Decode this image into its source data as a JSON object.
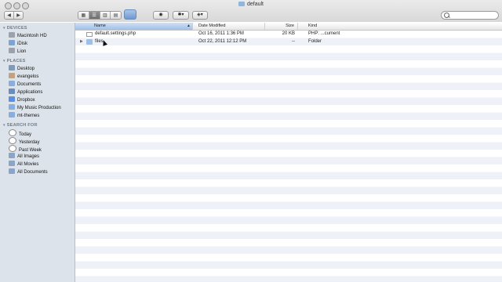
{
  "window": {
    "title": "default"
  },
  "toolbar": {
    "view_modes": [
      "icon-view",
      "list-view",
      "column-view",
      "coverflow-view"
    ],
    "selected_view": "list-view",
    "search_placeholder": ""
  },
  "sidebar": {
    "sections": [
      {
        "label": "DEVICES",
        "items": [
          {
            "label": "Macintosh HD",
            "icon": "hard-drive-icon"
          },
          {
            "label": "iDisk",
            "icon": "idisk-icon"
          },
          {
            "label": "Lion",
            "icon": "hard-drive-icon"
          }
        ]
      },
      {
        "label": "PLACES",
        "items": [
          {
            "label": "Desktop",
            "icon": "desktop-icon"
          },
          {
            "label": "evangelos",
            "icon": "home-icon"
          },
          {
            "label": "Documents",
            "icon": "documents-icon"
          },
          {
            "label": "Applications",
            "icon": "applications-icon"
          },
          {
            "label": "Dropbox",
            "icon": "dropbox-icon"
          },
          {
            "label": "My Music Production",
            "icon": "folder-icon"
          },
          {
            "label": "mt-themes",
            "icon": "folder-icon"
          }
        ]
      },
      {
        "label": "SEARCH FOR",
        "items": [
          {
            "label": "Today",
            "icon": "clock-icon"
          },
          {
            "label": "Yesterday",
            "icon": "clock-icon"
          },
          {
            "label": "Past Week",
            "icon": "clock-icon"
          },
          {
            "label": "All Images",
            "icon": "smart-folder-icon"
          },
          {
            "label": "All Movies",
            "icon": "smart-folder-icon"
          },
          {
            "label": "All Documents",
            "icon": "smart-folder-icon"
          }
        ]
      }
    ]
  },
  "columns": [
    "Name",
    "Date Modified",
    "Size",
    "Kind"
  ],
  "files": [
    {
      "name": "default.settings.php",
      "date": "Oct 16, 2011 1:36 PM",
      "size": "20 KB",
      "kind": "PHP: ...cument",
      "type": "document"
    },
    {
      "name": "files",
      "date": "Oct 22, 2011 12:12 PM",
      "size": "--",
      "kind": "Folder",
      "type": "folder"
    }
  ]
}
